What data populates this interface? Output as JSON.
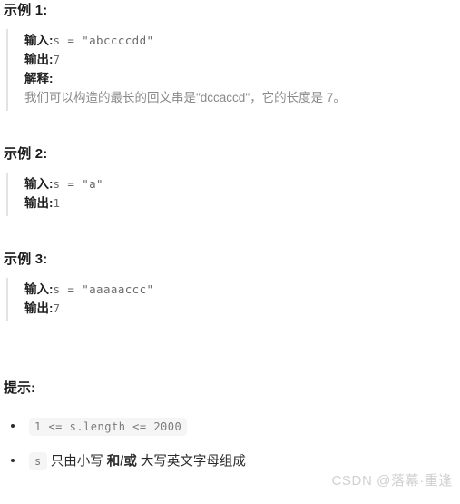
{
  "examples": [
    {
      "heading": "示例 1:",
      "input_label": "输入:",
      "input_value": "s = \"abccccdd\"",
      "output_label": "输出:",
      "output_value": "7",
      "explain_label": "解释:",
      "explain_text": "我们可以构造的最长的回文串是\"dccaccd\"，它的长度是 7。"
    },
    {
      "heading": "示例 2:",
      "input_label": "输入:",
      "input_value": "s = \"a\"",
      "output_label": "输出:",
      "output_value": "1"
    },
    {
      "heading": "示例 3:",
      "input_label": "输入:",
      "input_value": "s = \"aaaaaccc\"",
      "output_label": "输出:",
      "output_value": "7"
    }
  ],
  "hints": {
    "heading": "提示:",
    "items": [
      {
        "code": "1 <= s.length <= 2000",
        "text": ""
      },
      {
        "code": "s",
        "text_before": " 只由小写 ",
        "bold": "和/或",
        "text_after": " 大写英文字母组成"
      }
    ]
  },
  "watermark": "CSDN @落幕·重逢",
  "colors": {
    "text": "#2b2b2b",
    "muted": "#8a8a8a",
    "code": "#6a6a6a",
    "chip_bg": "#f5f5f5",
    "rule": "#e3e3e3",
    "watermark": "#d0d0d0"
  }
}
